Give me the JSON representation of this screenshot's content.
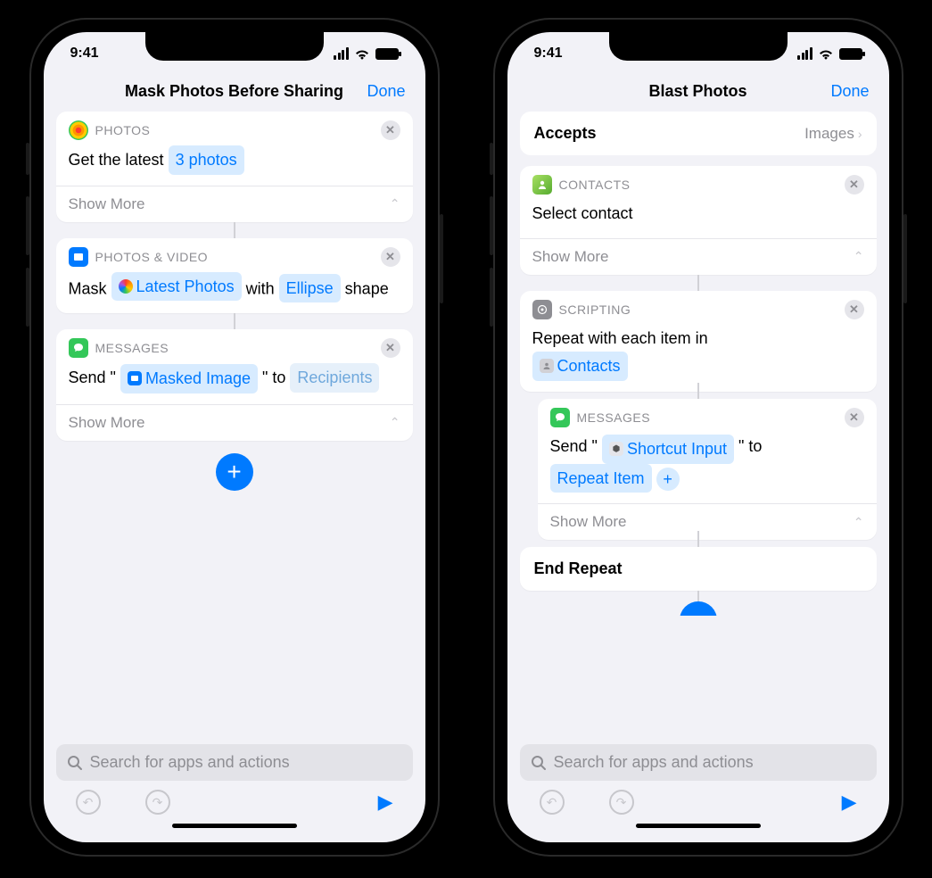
{
  "status": {
    "time": "9:41"
  },
  "left": {
    "title": "Mask Photos Before Sharing",
    "done": "Done",
    "cards": {
      "photos": {
        "head": "PHOTOS",
        "prefix": "Get the latest ",
        "chip": "3 photos",
        "showMore": "Show More"
      },
      "mask": {
        "head": "PHOTOS & VIDEO",
        "t1": "Mask ",
        "chip1": "Latest Photos",
        "t2": " with ",
        "chip2": "Ellipse",
        "t3": " shape"
      },
      "msg": {
        "head": "MESSAGES",
        "t1": "Send \" ",
        "chip": "Masked Image",
        "t2": " \" to ",
        "chip2": "Recipients",
        "showMore": "Show More"
      }
    },
    "search": "Search for apps and actions"
  },
  "right": {
    "title": "Blast Photos",
    "done": "Done",
    "accepts": {
      "label": "Accepts",
      "value": "Images"
    },
    "cards": {
      "contacts": {
        "head": "CONTACTS",
        "body": "Select contact",
        "showMore": "Show More"
      },
      "repeat": {
        "head": "SCRIPTING",
        "t1": "Repeat with each item in ",
        "chip": "Contacts"
      },
      "msg": {
        "head": "MESSAGES",
        "t1": "Send \" ",
        "chip1": "Shortcut Input",
        "t2": " \" to ",
        "chip2": "Repeat Item",
        "showMore": "Show More"
      },
      "end": "End Repeat"
    },
    "search": "Search for apps and actions"
  }
}
